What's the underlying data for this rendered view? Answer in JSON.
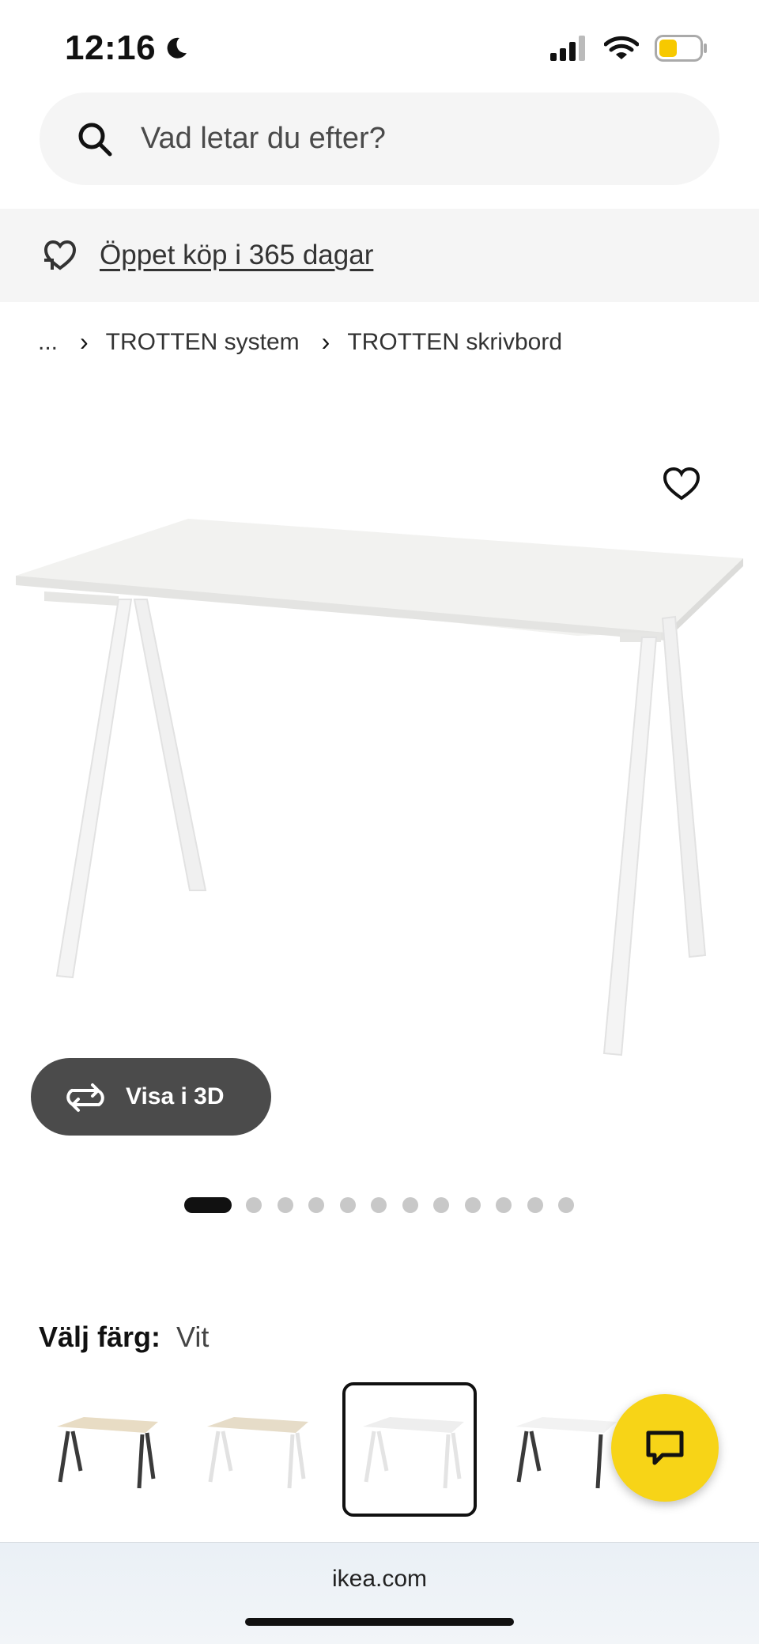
{
  "status_bar": {
    "time": "12:16",
    "moon_icon": "moon-icon",
    "signal_icon": "cell-signal-icon",
    "wifi_icon": "wifi-icon",
    "battery_icon": "battery-icon",
    "battery_color": "#f7c900"
  },
  "search": {
    "placeholder": "Vad letar du efter?",
    "icon": "search-icon"
  },
  "promo": {
    "text": "Öppet köp i 365 dagar",
    "icon": "return-heart-icon"
  },
  "breadcrumb": {
    "items": [
      "...",
      "TROTTEN system",
      "TROTTEN skrivbord"
    ],
    "separator_icon": "chevron-right-icon"
  },
  "product": {
    "favorite_icon": "heart-icon",
    "image": "white-desk-photo"
  },
  "visa3d": {
    "label": "Visa i 3D",
    "icon": "rotate-3d-icon"
  },
  "carousel": {
    "total_images": 13,
    "active_index": 0
  },
  "color": {
    "label": "Välj färg:",
    "value": "Vit"
  },
  "swatches": [
    {
      "top": "#e8dcc4",
      "legs": "#3a3a3a",
      "selected": false
    },
    {
      "top": "#e6dcc8",
      "legs": "#f2f2f2",
      "selected": false
    },
    {
      "top": "#f6f6f6",
      "legs": "#f2f2f2",
      "selected": true
    },
    {
      "top": "#f8f8f8",
      "legs": "#3a3a3a",
      "selected": false
    }
  ],
  "chat": {
    "icon": "chat-bubble-icon",
    "color": "#f7d417"
  },
  "browser": {
    "url": "ikea.com"
  }
}
